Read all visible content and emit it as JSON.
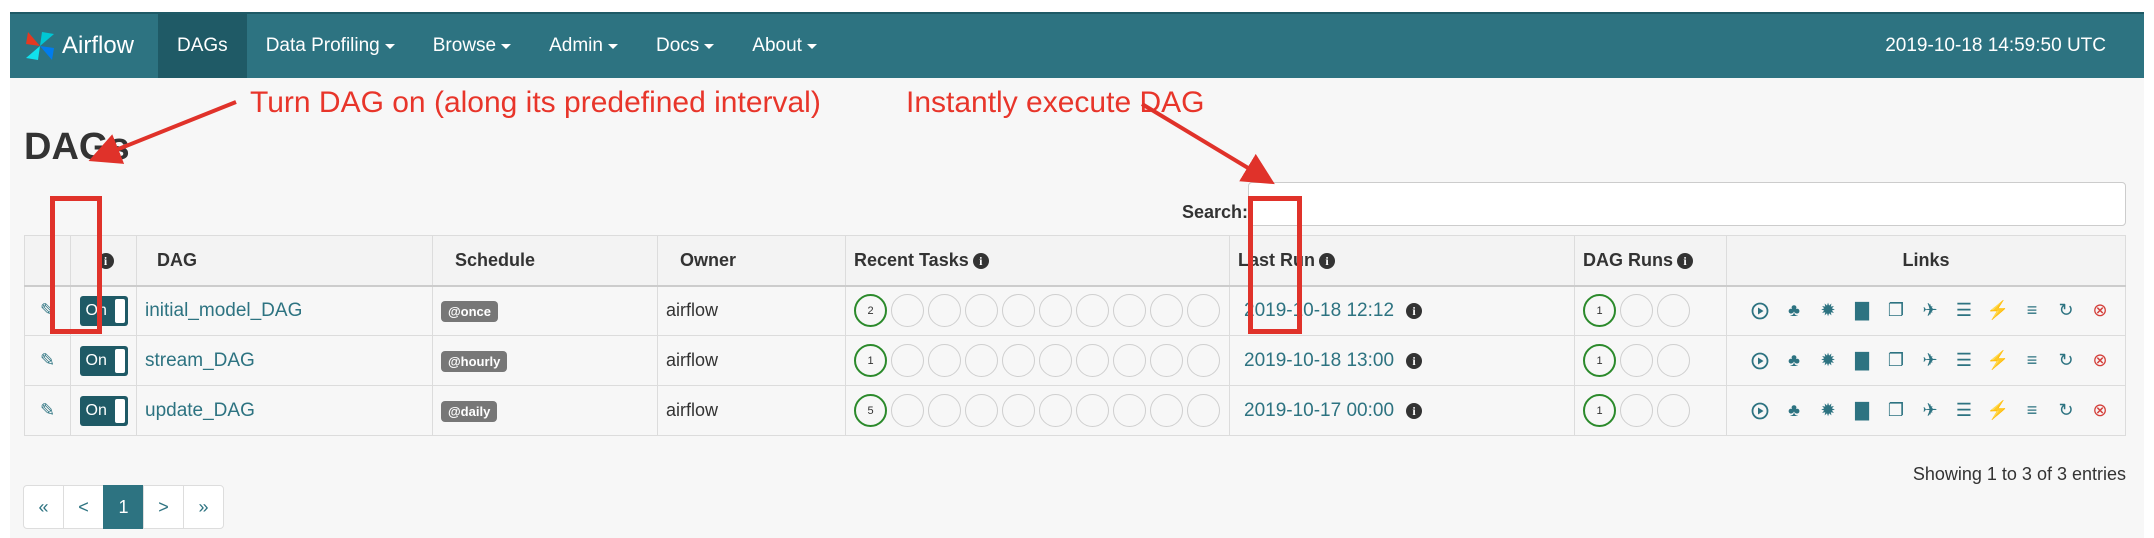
{
  "navbar": {
    "brand": "Airflow",
    "items": [
      {
        "label": "DAGs",
        "active": true,
        "dropdown": false
      },
      {
        "label": "Data Profiling",
        "active": false,
        "dropdown": true
      },
      {
        "label": "Browse",
        "active": false,
        "dropdown": true
      },
      {
        "label": "Admin",
        "active": false,
        "dropdown": true
      },
      {
        "label": "Docs",
        "active": false,
        "dropdown": true
      },
      {
        "label": "About",
        "active": false,
        "dropdown": true
      }
    ],
    "time": "2019-10-18 14:59:50 UTC"
  },
  "page": {
    "title": "DAGs",
    "search_label": "Search:",
    "search_value": ""
  },
  "table": {
    "headers": {
      "info": "i",
      "dag": "DAG",
      "schedule": "Schedule",
      "owner": "Owner",
      "recent_tasks": "Recent Tasks",
      "last_run": "Last Run",
      "dag_runs": "DAG Runs",
      "links": "Links"
    },
    "rows": [
      {
        "toggle": "On",
        "dag": "initial_model_DAG",
        "schedule": "@once",
        "owner": "airflow",
        "recent_task_count": "2",
        "last_run": "2019-10-18 12:12",
        "dag_run_count": "1"
      },
      {
        "toggle": "On",
        "dag": "stream_DAG",
        "schedule": "@hourly",
        "owner": "airflow",
        "recent_task_count": "1",
        "last_run": "2019-10-18 13:00",
        "dag_run_count": "1"
      },
      {
        "toggle": "On",
        "dag": "update_DAG",
        "schedule": "@daily",
        "owner": "airflow",
        "recent_task_count": "5",
        "last_run": "2019-10-17 00:00",
        "dag_run_count": "1"
      }
    ]
  },
  "footer": {
    "showing": "Showing 1 to 3 of 3 entries",
    "pagination": [
      "«",
      "<",
      "1",
      ">",
      "»"
    ]
  },
  "annotations": {
    "left": "Turn DAG on (along its predefined interval)",
    "right": "Instantly execute DAG"
  },
  "colors": {
    "navbar": "#2d7381",
    "nav_active": "#1f5a66",
    "link": "#2d7381",
    "success": "#2b8a2b",
    "annotation": "#e8352a",
    "delete": "#d43f3a"
  },
  "icons": [
    "edit-icon",
    "trigger-dag-icon",
    "tree-view-icon",
    "graph-view-icon",
    "duration-icon",
    "code-icon",
    "landing-times-icon",
    "gantt-icon",
    "logs-icon",
    "details-icon",
    "refresh-icon",
    "delete-icon"
  ]
}
